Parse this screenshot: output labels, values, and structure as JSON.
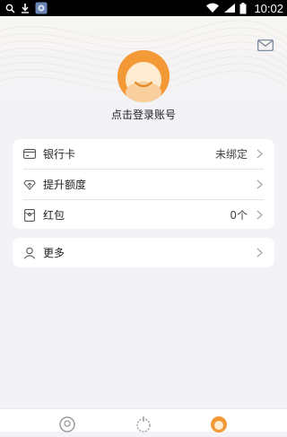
{
  "status_bar": {
    "time": "10:02",
    "icons": [
      "search-icon",
      "download-icon",
      "app-notification-icon",
      "wifi-icon",
      "signal-icon",
      "battery-icon"
    ]
  },
  "header": {
    "mail_icon": "envelope-icon"
  },
  "profile": {
    "avatar_icon": "user-avatar-icon",
    "avatar_color": "#f39a36",
    "login_label": "点击登录账号"
  },
  "menu_card": {
    "items": [
      {
        "label": "银行卡",
        "value": "未绑定",
        "icon": "bank-card-icon"
      },
      {
        "label": "提升额度",
        "value": "",
        "icon": "raise-limit-icon"
      },
      {
        "label": "红包",
        "value": "0个",
        "icon": "red-packet-icon"
      }
    ]
  },
  "more_card": {
    "label": "更多",
    "icon": "more-user-icon"
  },
  "tab_bar": {
    "tabs": [
      {
        "icon": "home-tab-icon",
        "active": false
      },
      {
        "icon": "center-tab-icon",
        "active": false
      },
      {
        "icon": "me-tab-icon",
        "active": true
      }
    ],
    "accent": "#f39a36"
  }
}
